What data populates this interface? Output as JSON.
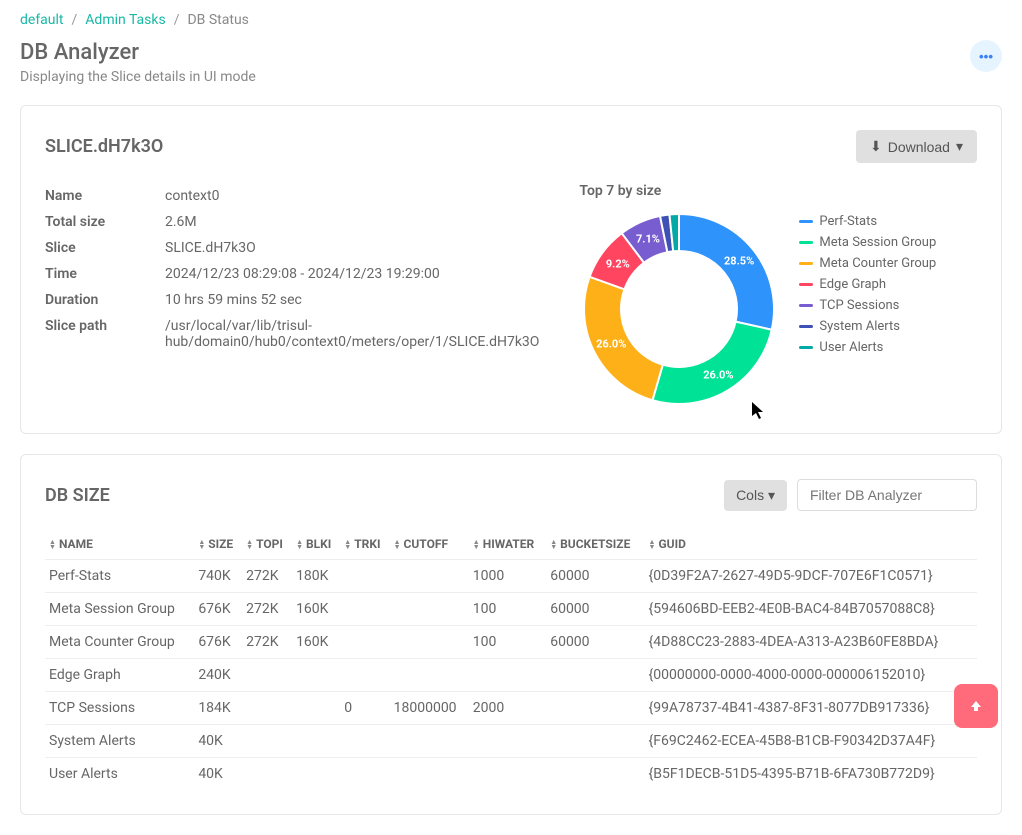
{
  "breadcrumb": {
    "home": "default",
    "section": "Admin Tasks",
    "current": "DB Status"
  },
  "page": {
    "title": "DB Analyzer",
    "subtitle": "Displaying the Slice details in UI mode"
  },
  "slice": {
    "title": "SLICE.dH7k3O",
    "download_label": "Download",
    "rows": [
      {
        "label": "Name",
        "value": "context0"
      },
      {
        "label": "Total size",
        "value": "2.6M"
      },
      {
        "label": "Slice",
        "value": "SLICE.dH7k3O"
      },
      {
        "label": "Time",
        "value": "2024/12/23 08:29:08 - 2024/12/23 19:29:00"
      },
      {
        "label": "Duration",
        "value": "10 hrs 59 mins 52 sec"
      },
      {
        "label": "Slice path",
        "value": "/usr/local/var/lib/trisul-hub/domain0/hub0/context0/meters/oper/1/SLICE.dH7k3O"
      }
    ]
  },
  "chart_data": {
    "type": "pie",
    "title": "Top 7 by size",
    "series": [
      {
        "name": "Perf-Stats",
        "value": 28.5,
        "color": "#2e93fa",
        "label": "28.5%"
      },
      {
        "name": "Meta Session Group",
        "value": 26.0,
        "color": "#00e396",
        "label": "26.0%"
      },
      {
        "name": "Meta Counter Group",
        "value": 26.0,
        "color": "#feb019",
        "label": "26.0%"
      },
      {
        "name": "Edge Graph",
        "value": 9.2,
        "color": "#ff4560",
        "label": "9.2%"
      },
      {
        "name": "TCP Sessions",
        "value": 7.1,
        "color": "#775dd0",
        "label": "7.1%"
      },
      {
        "name": "System Alerts",
        "value": 1.6,
        "color": "#3f51b5",
        "label": ""
      },
      {
        "name": "User Alerts",
        "value": 1.6,
        "color": "#03a9a4",
        "label": ""
      }
    ]
  },
  "dbsize": {
    "title": "DB SIZE",
    "cols_label": "Cols",
    "filter_placeholder": "Filter DB Analyzer",
    "headers": [
      "NAME",
      "SIZE",
      "TOPI",
      "BLKI",
      "TRKI",
      "CUTOFF",
      "HIWATER",
      "BUCKETSIZE",
      "GUID"
    ],
    "rows": [
      {
        "name": "Perf-Stats",
        "size": "740K",
        "topi": "272K",
        "blki": "180K",
        "trki": "",
        "cutoff": "",
        "hiwater": "1000",
        "bucketsize": "60000",
        "guid": "{0D39F2A7-2627-49D5-9DCF-707E6F1C0571}"
      },
      {
        "name": "Meta Session Group",
        "size": "676K",
        "topi": "272K",
        "blki": "160K",
        "trki": "",
        "cutoff": "",
        "hiwater": "100",
        "bucketsize": "60000",
        "guid": "{594606BD-EEB2-4E0B-BAC4-84B7057088C8}"
      },
      {
        "name": "Meta Counter Group",
        "size": "676K",
        "topi": "272K",
        "blki": "160K",
        "trki": "",
        "cutoff": "",
        "hiwater": "100",
        "bucketsize": "60000",
        "guid": "{4D88CC23-2883-4DEA-A313-A23B60FE8BDA}"
      },
      {
        "name": "Edge Graph",
        "size": "240K",
        "topi": "",
        "blki": "",
        "trki": "",
        "cutoff": "",
        "hiwater": "",
        "bucketsize": "",
        "guid": "{00000000-0000-4000-0000-000006152010}"
      },
      {
        "name": "TCP Sessions",
        "size": "184K",
        "topi": "",
        "blki": "",
        "trki": "0",
        "cutoff": "18000000",
        "hiwater": "2000",
        "bucketsize": "",
        "guid": "{99A78737-4B41-4387-8F31-8077DB917336}"
      },
      {
        "name": "System Alerts",
        "size": "40K",
        "topi": "",
        "blki": "",
        "trki": "",
        "cutoff": "",
        "hiwater": "",
        "bucketsize": "",
        "guid": "{F69C2462-ECEA-45B8-B1CB-F90342D37A4F}"
      },
      {
        "name": "User Alerts",
        "size": "40K",
        "topi": "",
        "blki": "",
        "trki": "",
        "cutoff": "",
        "hiwater": "",
        "bucketsize": "",
        "guid": "{B5F1DECB-51D5-4395-B71B-6FA730B772D9}"
      }
    ]
  },
  "icons": {
    "caret": "▾",
    "download": "⬇"
  }
}
